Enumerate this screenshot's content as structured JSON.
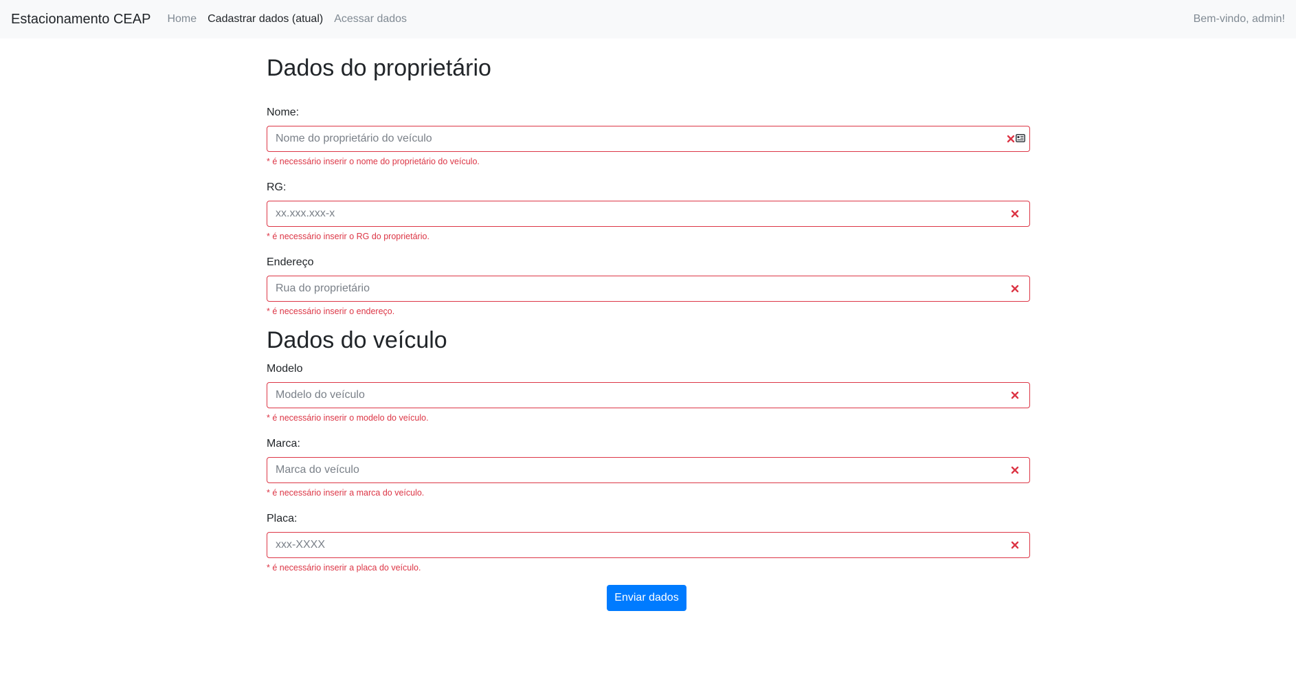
{
  "navbar": {
    "brand": "Estacionamento CEAP",
    "links": [
      {
        "label": "Home",
        "active": false
      },
      {
        "label": "Cadastrar dados (atual)",
        "active": true
      },
      {
        "label": "Acessar dados",
        "active": false
      }
    ],
    "welcome": "Bem-vindo, admin!"
  },
  "owner_section": {
    "title": "Dados do proprietário",
    "fields": [
      {
        "label": "Nome:",
        "placeholder": "Nome do proprietário do veículo",
        "value": "",
        "error": "* é necessário inserir o nome do proprietário do veículo.",
        "icons": [
          "invalid-x-icon",
          "autofill-card-icon"
        ]
      },
      {
        "label": "RG:",
        "placeholder": "xx.xxx.xxx-x",
        "value": "",
        "error": "* é necessário inserir o RG do proprietário.",
        "icons": [
          "invalid-x-icon"
        ]
      },
      {
        "label": "Endereço",
        "placeholder": "Rua do proprietário",
        "value": "",
        "error": "* é necessário inserir o endereço.",
        "icons": [
          "invalid-x-icon"
        ]
      }
    ]
  },
  "vehicle_section": {
    "title": "Dados do veículo",
    "fields": [
      {
        "label": "Modelo",
        "placeholder": "Modelo do veículo",
        "value": "",
        "error": "* é necessário inserir o modelo do veículo.",
        "icons": [
          "invalid-x-icon"
        ]
      },
      {
        "label": "Marca:",
        "placeholder": "Marca do veículo",
        "value": "",
        "error": "* é necessário inserir a marca do veículo.",
        "icons": [
          "invalid-x-icon"
        ]
      },
      {
        "label": "Placa:",
        "placeholder": "xxx-XXXX",
        "value": "",
        "error": "* é necessário inserir a placa do veículo.",
        "icons": [
          "invalid-x-icon"
        ]
      }
    ]
  },
  "submit_label": "Enviar dados",
  "colors": {
    "navbar_bg": "#f8f9fa",
    "invalid": "#dc3545",
    "primary": "#007bff",
    "muted_link": "#808a93"
  }
}
